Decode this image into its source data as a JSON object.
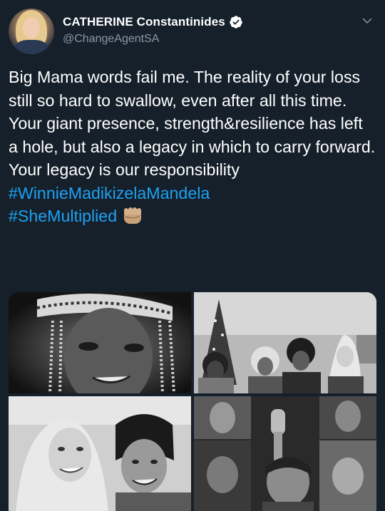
{
  "tweet": {
    "author": {
      "display_name": "CATHERINE Constantinides",
      "handle": "@ChangeAgentSA",
      "verified": true
    },
    "text": "Big Mama words fail me. The reality of your loss still so hard to swallow, even after all this time. Your giant presence, strength&resilience has left a hole, but also a legacy in which to carry forward. Your legacy is our responsibility",
    "hashtags": [
      "#WinnieMadikizelaMandela",
      "#SheMultiplied"
    ],
    "emoji": "raised-fist-medium-skin-tone",
    "media": [
      {
        "name": "photo-portrait-beaded-headdress"
      },
      {
        "name": "photo-group-christmas-tree"
      },
      {
        "name": "photo-selfie-two-women"
      },
      {
        "name": "photo-collage-raised-fist"
      }
    ]
  },
  "colors": {
    "background": "#15202b",
    "text": "#ffffff",
    "secondary_text": "#8899a6",
    "link": "#1da1f2",
    "verified_badge": "#ffffff"
  },
  "icons": {
    "verified": "verified-badge-icon",
    "more": "chevron-down-icon"
  }
}
